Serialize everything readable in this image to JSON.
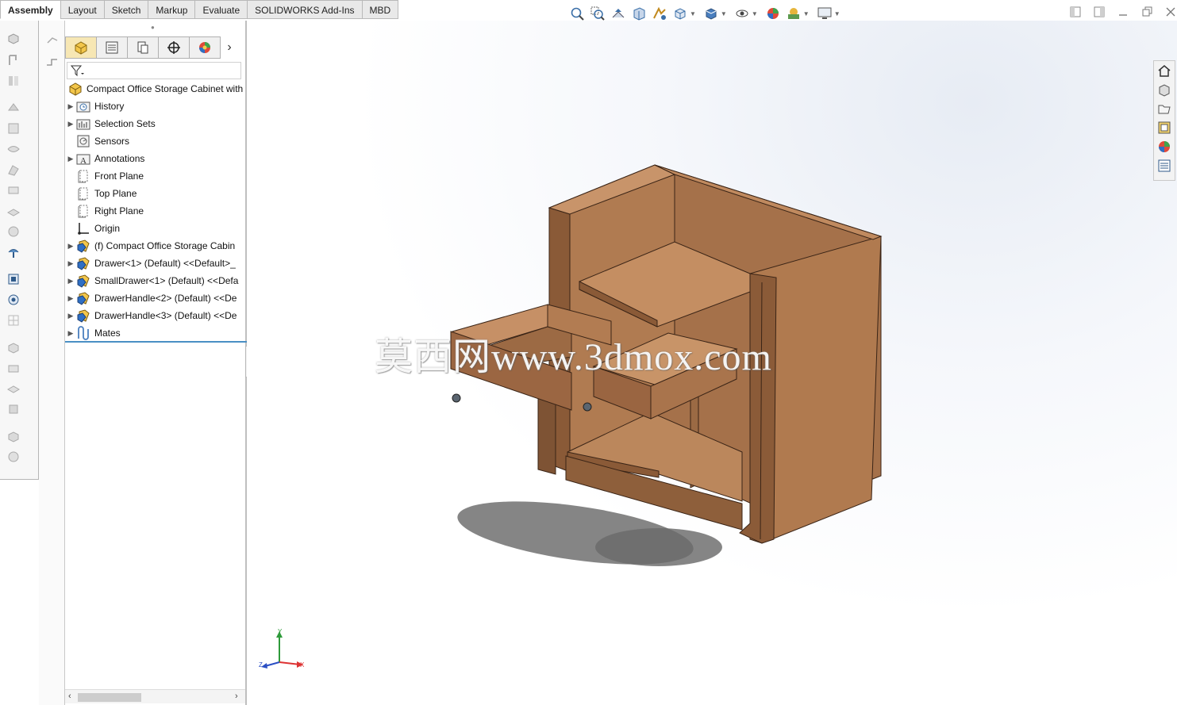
{
  "ribbon": {
    "tabs": [
      "Assembly",
      "Layout",
      "Sketch",
      "Markup",
      "Evaluate",
      "SOLIDWORKS Add-Ins",
      "MBD"
    ],
    "active_tab": "Assembly"
  },
  "view_toolbar": {
    "buttons": [
      "zoom-to-fit-icon",
      "zoom-to-area-icon",
      "previous-view-icon",
      "section-view-icon",
      "dynamic-annotation-icon",
      "view-orientation-icon",
      "display-style-icon",
      "hide-show-items-icon",
      "edit-appearance-icon",
      "apply-scene-icon",
      "view-settings-icon"
    ]
  },
  "feature_manager": {
    "tabs": [
      "feature-manager-icon",
      "property-manager-icon",
      "configuration-manager-icon",
      "dimxpert-icon",
      "display-manager-icon"
    ],
    "tree": [
      {
        "label": "Compact Office Storage Cabinet with",
        "icon": "assembly-icon",
        "expandable": false,
        "root": true
      },
      {
        "label": "History",
        "icon": "history-folder-icon",
        "expandable": true
      },
      {
        "label": "Selection Sets",
        "icon": "selection-sets-icon",
        "expandable": true
      },
      {
        "label": "Sensors",
        "icon": "sensors-icon",
        "expandable": false
      },
      {
        "label": "Annotations",
        "icon": "annotations-icon",
        "expandable": true
      },
      {
        "label": "Front Plane",
        "icon": "plane-icon",
        "expandable": false
      },
      {
        "label": "Top Plane",
        "icon": "plane-icon",
        "expandable": false
      },
      {
        "label": "Right Plane",
        "icon": "plane-icon",
        "expandable": false
      },
      {
        "label": "Origin",
        "icon": "origin-icon",
        "expandable": false
      },
      {
        "label": "(f) Compact Office Storage Cabin",
        "icon": "part-icon",
        "expandable": true
      },
      {
        "label": "Drawer<1> (Default) <<Default>_",
        "icon": "part-icon",
        "expandable": true
      },
      {
        "label": "SmallDrawer<1> (Default) <<Defa",
        "icon": "part-icon",
        "expandable": true
      },
      {
        "label": "DrawerHandle<2> (Default) <<De",
        "icon": "part-icon",
        "expandable": true
      },
      {
        "label": "DrawerHandle<3> (Default) <<De",
        "icon": "part-icon",
        "expandable": true
      },
      {
        "label": "Mates",
        "icon": "mates-icon",
        "expandable": true
      }
    ]
  },
  "viewport": {
    "watermark": "莫西网www.3dmox.com",
    "triad": {
      "x": "X",
      "y": "Y",
      "z": "Z"
    },
    "colors": {
      "wood_light": "#b98459",
      "wood_mid": "#a36f47",
      "wood_dark": "#7e5334",
      "edge": "#3a2416"
    }
  },
  "task_pane": [
    "home-icon",
    "design-library-icon",
    "file-explorer-icon",
    "view-palette-icon",
    "appearances-icon",
    "custom-properties-icon"
  ]
}
